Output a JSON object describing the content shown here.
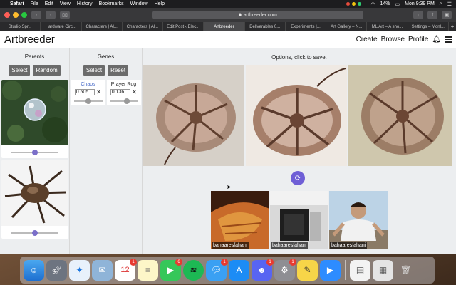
{
  "menubar": {
    "app_name": "Safari",
    "menus": [
      "File",
      "Edit",
      "View",
      "History",
      "Bookmarks",
      "Window",
      "Help"
    ],
    "battery": "14%",
    "clock": "Mon 9:39 PM"
  },
  "browser": {
    "url": "artbreeder.com",
    "tabs": [
      "Studio Spr...",
      "Hardware Circ...",
      "Characters | Al...",
      "Characters | Al...",
      "Edit Post ‹ Elec...",
      "Artbreeder",
      "Deliverables 0...",
      "Experiments |...",
      "Art Gallery – N...",
      "ML Art – A sho...",
      "Settings – Monl..."
    ],
    "active_tab": 5
  },
  "site": {
    "logo": "Artbreeder",
    "nav": {
      "create": "Create",
      "browse": "Browse",
      "profile": "Profile"
    }
  },
  "parents": {
    "title": "Parents",
    "select_label": "Select",
    "random_label": "Random",
    "slider_positions": [
      0.5,
      0.5
    ]
  },
  "genes": {
    "title": "Genes",
    "select_label": "Select",
    "reset_label": "Reset",
    "items": [
      {
        "name": "Chaos",
        "value": "0.505"
      },
      {
        "name": "Prayer Rug",
        "value": "0.136"
      }
    ]
  },
  "options": {
    "title": "Options, click to save."
  },
  "children": [
    {
      "author": "bahaaresfahani"
    },
    {
      "author": "bahaaresfahani"
    },
    {
      "author": "bahaaresfahani"
    }
  ],
  "dock": {
    "badges": {
      "calendar": "1",
      "facetime": "6",
      "messages": "1",
      "discord": "1",
      "settings": "1"
    },
    "calendar_day": "12"
  },
  "colors": {
    "accent": "#6f5fd6",
    "button": "#6b6b6b",
    "link": "#4a6cc9"
  }
}
